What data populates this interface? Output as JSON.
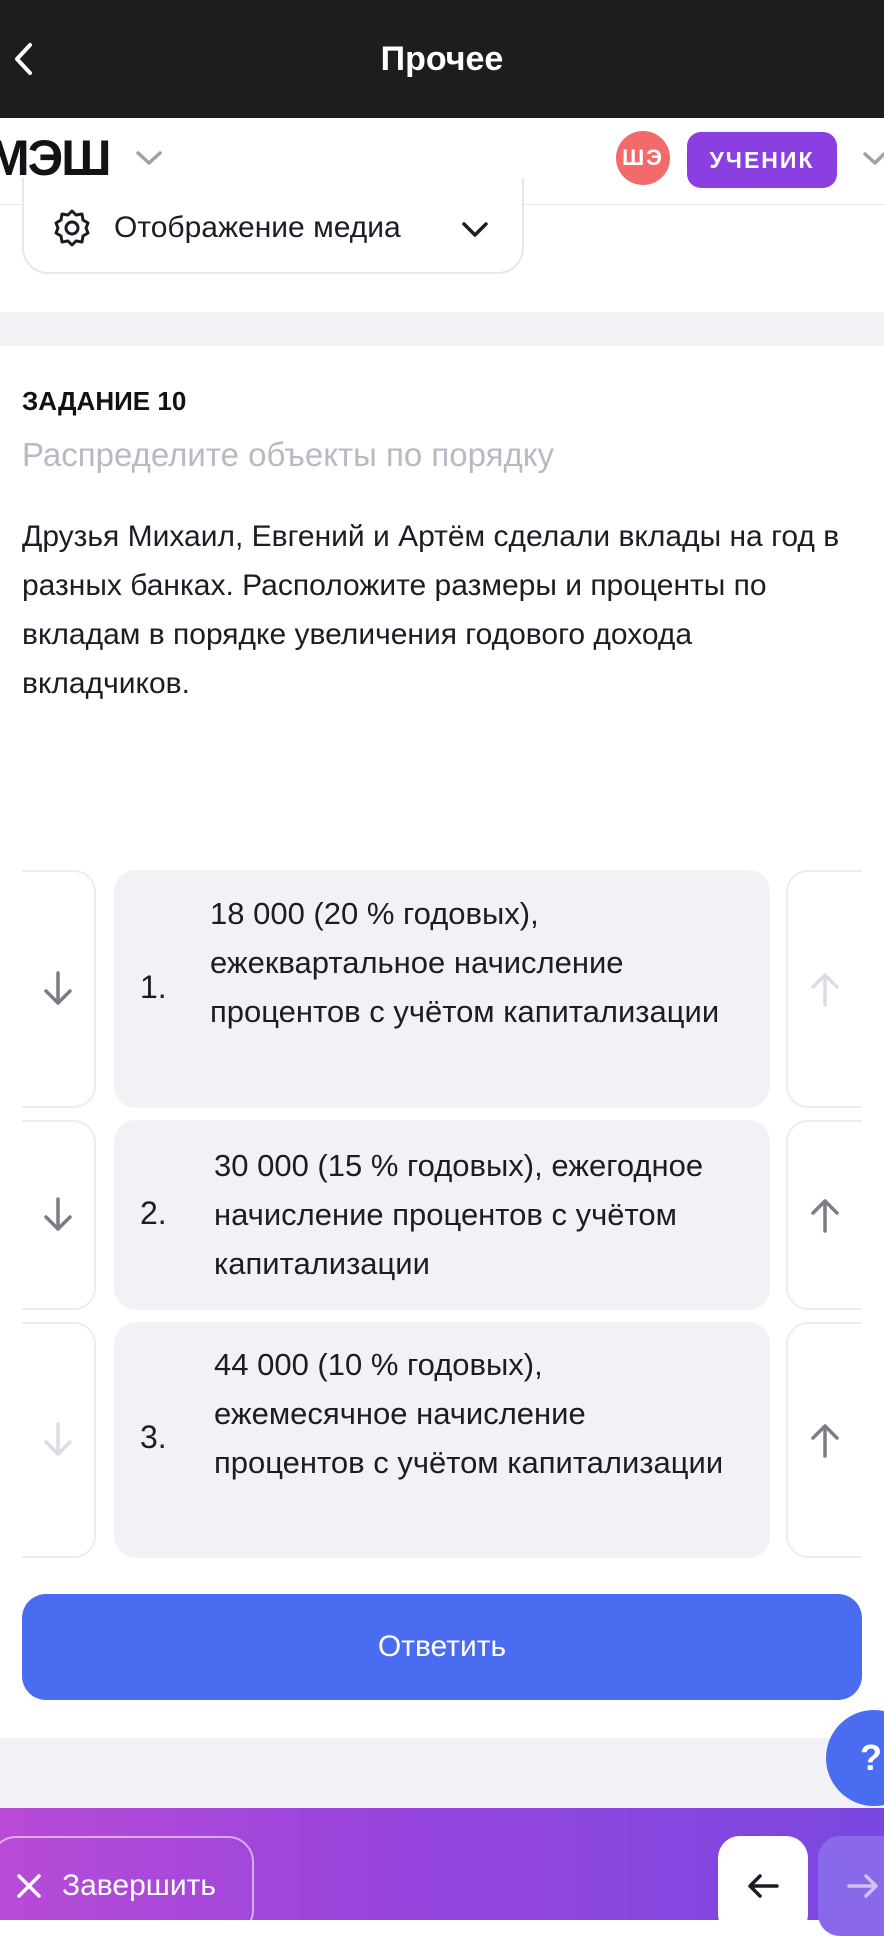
{
  "topbar": {
    "title": "Прочее"
  },
  "brand": {
    "logo": "МЭШ",
    "avatar_initials": "ШЭ",
    "role": "УЧЕНИК"
  },
  "media": {
    "label": "Отображение медиа"
  },
  "task": {
    "number": "ЗАДАНИЕ 10",
    "instruction": "Распределите объекты по порядку",
    "text": "Друзья Михаил, Евгений и Артём сделали вклады на год в разных банках. Расположите размеры и проценты по вкладам в порядке увеличения годового дохода вкладчиков."
  },
  "items": [
    {
      "index": "1.",
      "text": "18 000 (20 % годовых), ежеквартальное начисление процентов с учётом капитализации"
    },
    {
      "index": "2.",
      "text": "30 000 (15 % годовых), ежегодное начисление процентов с учётом капитализации"
    },
    {
      "index": "3.",
      "text": "44 000 (10 % годовых), ежемесячное начисление процентов с учётом капитализации"
    }
  ],
  "answer_label": "Ответить",
  "help_label": "?",
  "bottom": {
    "finish_label": "Завершить"
  },
  "colors": {
    "accent": "#4a6cf0",
    "role": "#8b3fe0",
    "avatar": "#f26a6a",
    "card": "#f2f2f6"
  }
}
